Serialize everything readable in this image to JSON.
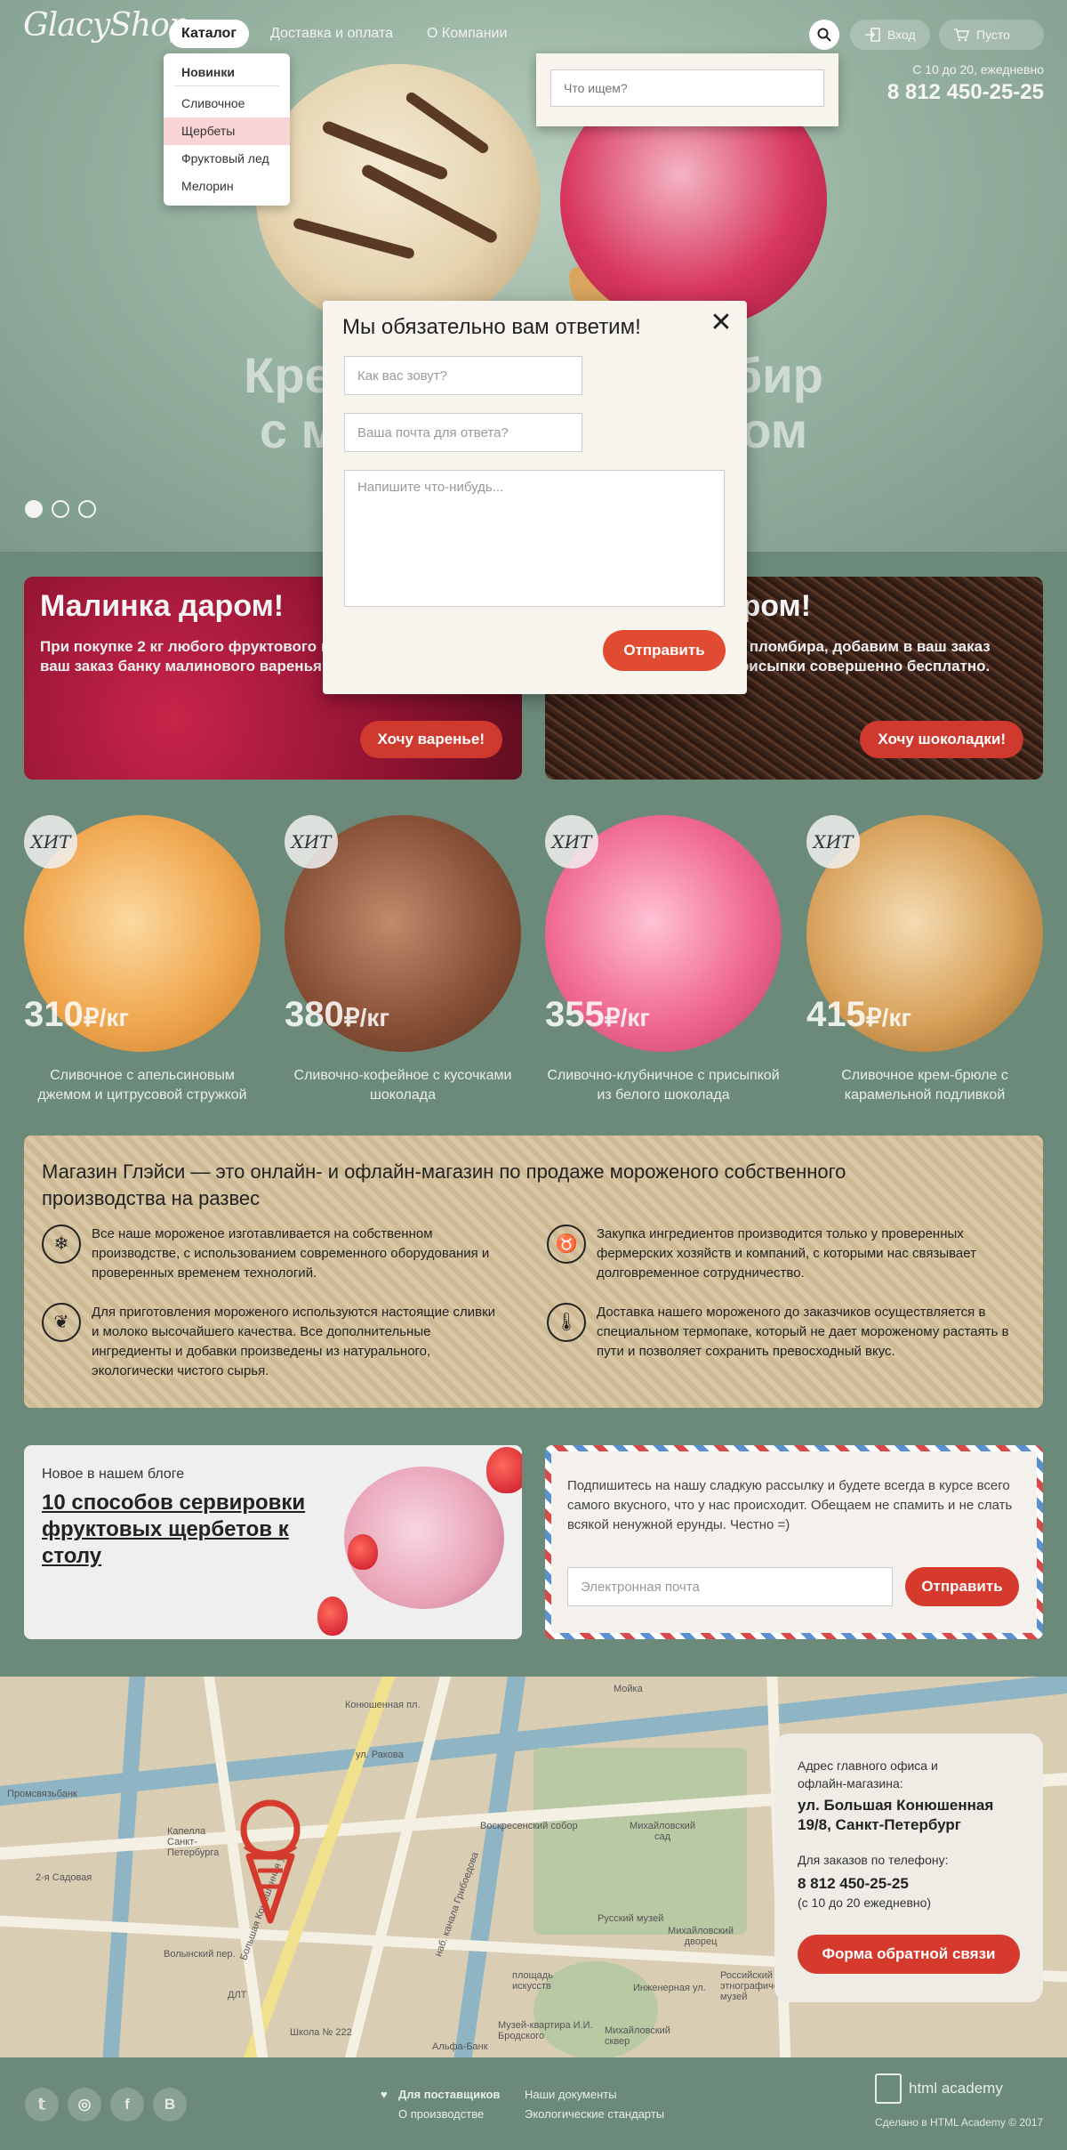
{
  "header": {
    "logo": "GlacyShop",
    "nav": [
      "Каталог",
      "Доставка и оплата",
      "О Компании"
    ],
    "login": "Вход",
    "cart": "Пусто",
    "hours": "С 10 до 20, ежедневно",
    "phone": "8 812 450-25-25"
  },
  "catalog_menu": {
    "title": "Новинки",
    "items": [
      "Сливочное",
      "Щербеты",
      "Фруктовый лед",
      "Мелорин"
    ],
    "highlighted": "Щербеты"
  },
  "search": {
    "placeholder": "Что ищем?"
  },
  "slider": {
    "title_line1": "Крем-брюле и пломбир",
    "title_line2": "с малиновым джемом",
    "dots": 3,
    "active_dot": 1
  },
  "modal": {
    "title": "Мы обязательно вам ответим!",
    "name_placeholder": "Как вас зовут?",
    "email_placeholder": "Ваша почта для ответа?",
    "message_placeholder": "Напишите что-нибудь...",
    "submit": "Отправить"
  },
  "promos": [
    {
      "title": "Малинка даром!",
      "text": "При покупке 2 кг любого фруктового мороженого, добавим в ваш заказ банку малинового варенья в подарок.",
      "button": "Хочу варенье!"
    },
    {
      "title": "Шоколад даром!",
      "text": "При покупке 2 кг любого пломбира, добавим в ваш заказ упаковку шоколадной присыпки совершенно бесплатно.",
      "button": "Хочу шоколадки!"
    }
  ],
  "products": [
    {
      "badge": "ХИТ",
      "price": "310",
      "unit": "₽/кг",
      "name": "Сливочное с апельсиновым джемом и цитрусовой стружкой",
      "color": "#f0a850"
    },
    {
      "badge": "ХИТ",
      "price": "380",
      "unit": "₽/кг",
      "name": "Сливочно-кофейное с кусочками шоколада",
      "color": "#8a5238"
    },
    {
      "badge": "ХИТ",
      "price": "355",
      "unit": "₽/кг",
      "name": "Сливочно-клубничное с присыпкой из белого шоколада",
      "color": "#f06a92"
    },
    {
      "badge": "ХИТ",
      "price": "415",
      "unit": "₽/кг",
      "name": "Сливочное крем-брюле с карамельной подливкой",
      "color": "#d8a25c"
    }
  ],
  "about": {
    "title": "Магазин Глэйси — это онлайн- и офлайн-магазин по продаже мороженого собственного производства на развес",
    "features": [
      {
        "icon": "ice-cream-icon",
        "text": "Все наше мороженое изготавливается на собственном производстве, с использованием современного оборудования и проверенных временем технологий."
      },
      {
        "icon": "cow-icon",
        "text": "Закупка ингредиентов  производится только у проверенных фермерских хозяйств и компаний, с которыми нас связывает долговременное сотрудничество."
      },
      {
        "icon": "leaf-icon",
        "text": "Для приготовления мороженого используются настоящие сливки и молоко высочайшего качества. Все дополнительные ингредиенты и добавки произведены из натурального, экологически чистого сырья."
      },
      {
        "icon": "thermometer-icon",
        "text": "Доставка нашего мороженого до заказчиков осуществляется в специальном термопаке, который не дает мороженому растаять в пути и позволяет сохранить превосходный вкус."
      }
    ]
  },
  "blog": {
    "kicker": "Новое в нашем блоге",
    "title": "10 способов сервировки фруктовых щербетов к столу"
  },
  "subscribe": {
    "text": "Подпишитесь на нашу сладкую рассылку и будете всегда в курсе всего самого вкусного, что у нас происходит. Обещаем не спамить и не слать всякой ненужной ерунды. Честно =)",
    "placeholder": "Электронная почта",
    "button": "Отправить"
  },
  "map_labels": [
    "Конюшенная пл.",
    "Мойка",
    "Михайловский сад",
    "Русский музей",
    "Михайловский дворец",
    "Воскресенский собор",
    "Капелла Санкт-Петербурга",
    "Инженерная ул.",
    "площадь искусств",
    "Музей-квартира И.И. Бродского",
    "Михайловский сквер",
    "Школа № 222",
    "Альфа-Банк",
    "Волынский пер.",
    "ул. Ракова",
    "Большая Конюшенная ул.",
    "наб. канала Грибоедова",
    "Промсвязьбанк",
    "ДЛТ",
    "Российский этнографический музей",
    "2-я Садовая"
  ],
  "contact_card": {
    "address_label": "Адрес главного офиса и офлайн-магазина:",
    "address": "ул. Большая Конюшенная 19/8, Санкт-Петербург",
    "phone_label": "Для заказов по телефону:",
    "phone": "8 812 450-25-25",
    "hours": "(с 10 до 20 ежедневно)",
    "button": "Форма обратной связи"
  },
  "footer": {
    "social": [
      "twitter-icon",
      "instagram-icon",
      "facebook-icon",
      "vk-icon"
    ],
    "links": [
      "Для поставщиков",
      "О производстве",
      "Наши документы",
      "Экологические стандарты"
    ],
    "academy": "html academy",
    "made": "Сделано в HTML Academy © 2017"
  },
  "colors": {
    "accent": "#d63a2d",
    "background": "#6b8a7a",
    "card": "#efece6"
  }
}
